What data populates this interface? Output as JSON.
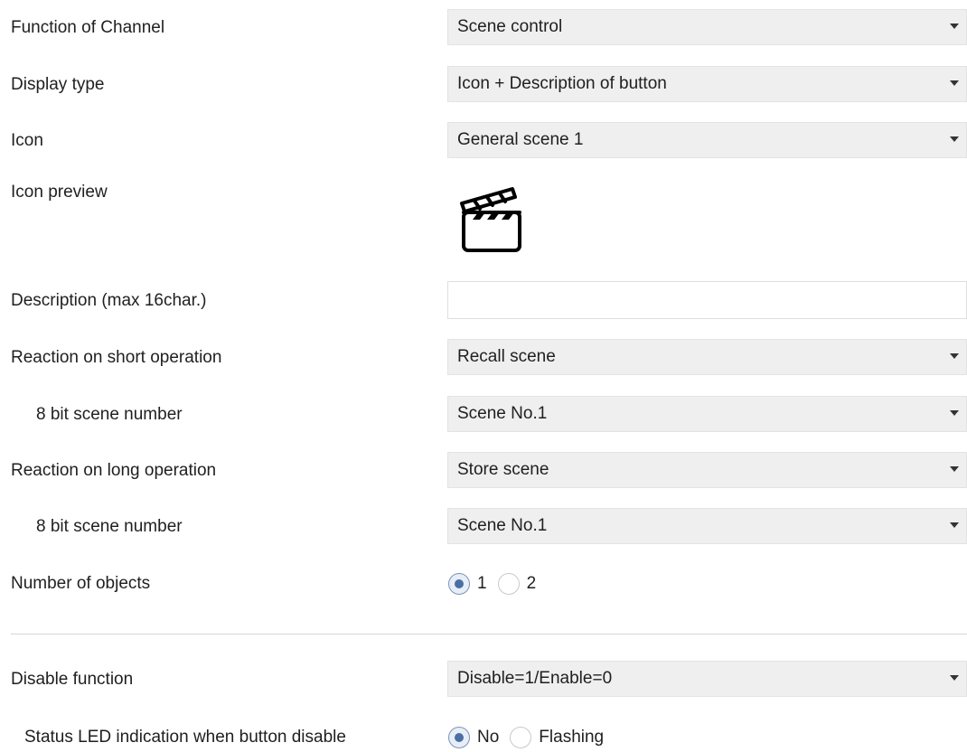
{
  "rows": {
    "function_of_channel": {
      "label": "Function of Channel",
      "value": "Scene control"
    },
    "display_type": {
      "label": "Display type",
      "value": "Icon + Description of button"
    },
    "icon": {
      "label": "Icon",
      "value": "General scene 1"
    },
    "icon_preview": {
      "label": "Icon preview",
      "icon_name": "clapperboard-icon"
    },
    "description": {
      "label": "Description (max 16char.)",
      "value": ""
    },
    "short_operation": {
      "label": "Reaction on short operation",
      "value": "Recall scene"
    },
    "short_scene_number": {
      "label": "8 bit scene number",
      "value": "Scene No.1"
    },
    "long_operation": {
      "label": "Reaction on long operation",
      "value": "Store scene"
    },
    "long_scene_number": {
      "label": "8 bit scene number",
      "value": "Scene No.1"
    },
    "number_of_objects": {
      "label": "Number of objects",
      "options": [
        "1",
        "2"
      ],
      "selected": "1"
    },
    "disable_function": {
      "label": "Disable function",
      "value": "Disable=1/Enable=0"
    },
    "status_led": {
      "label": "Status LED indication when button disable",
      "options": [
        "No",
        "Flashing"
      ],
      "selected": "No"
    }
  },
  "colors": {
    "dropdown_bg": "#efefef",
    "radio_selected": "#4a6fa5",
    "divider": "#d4d4d4"
  }
}
